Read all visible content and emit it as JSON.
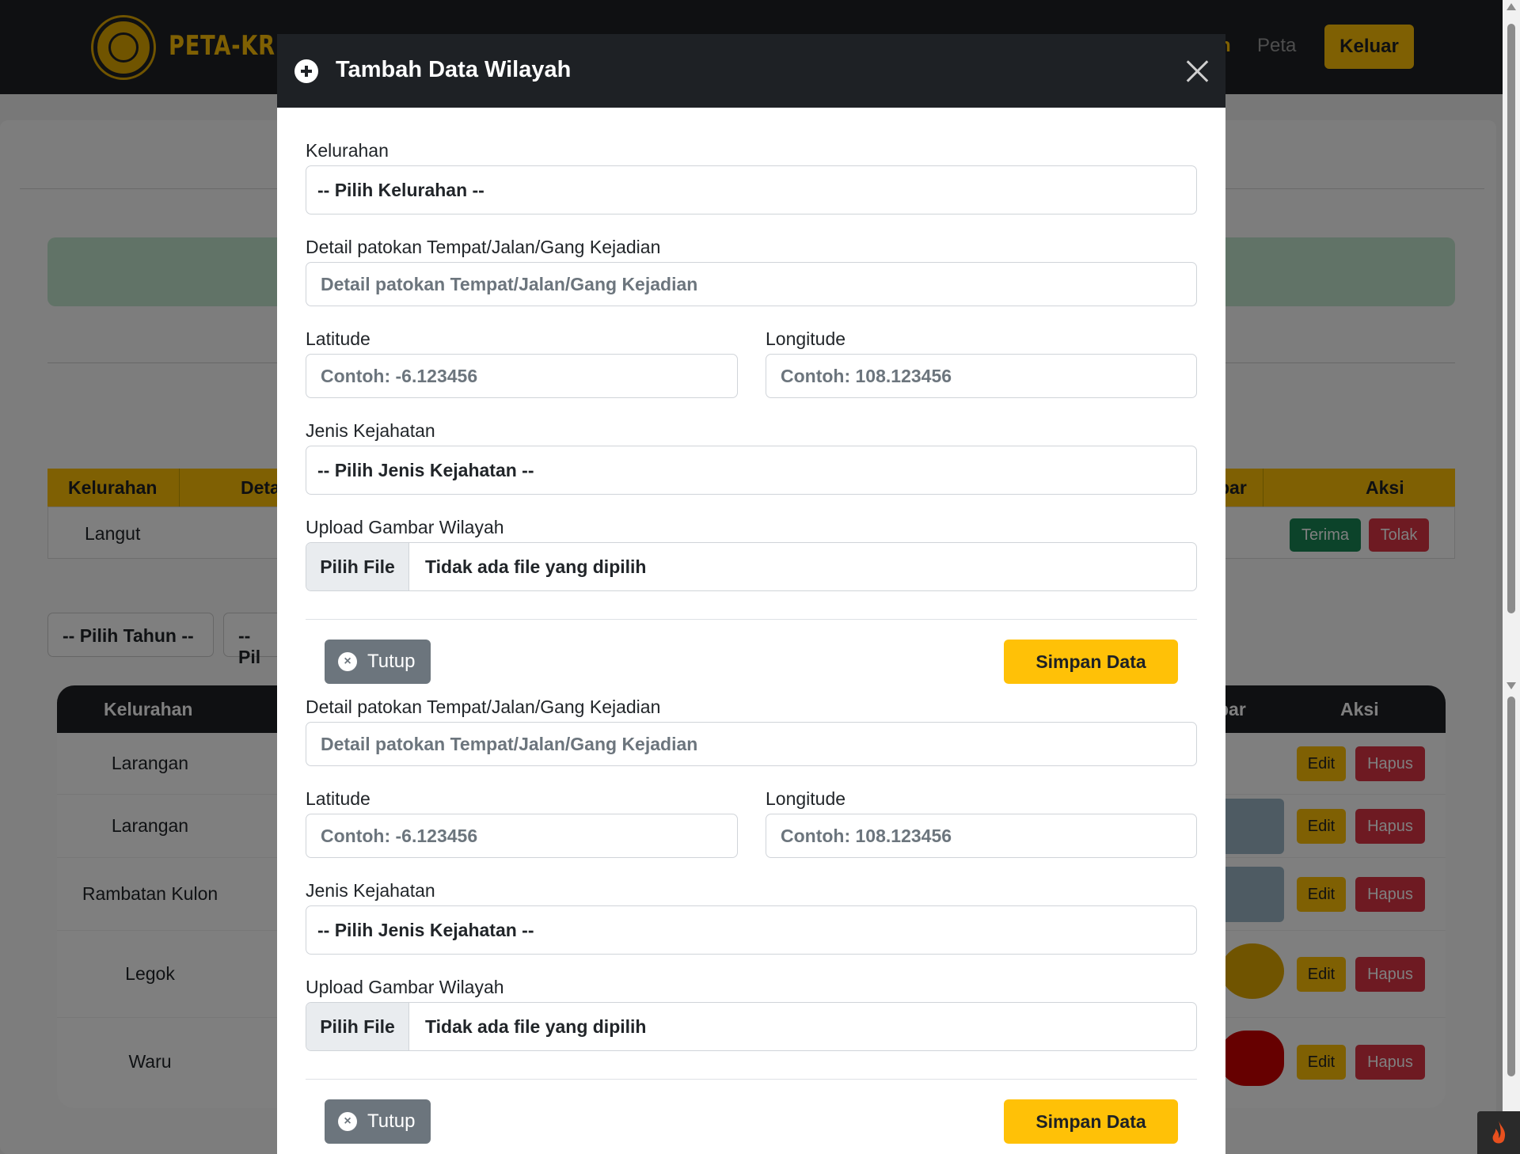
{
  "navbar": {
    "brand": "PETA-KRIM",
    "nav_partial": "h",
    "nav_peta": "Peta",
    "keluar": "Keluar"
  },
  "pending_table": {
    "headers": [
      "Kelurahan",
      "Deta",
      "bar",
      "Aksi"
    ],
    "row": {
      "kelurahan": "Langut",
      "terima": "Terima",
      "tolak": "Tolak"
    }
  },
  "filters": {
    "tahun": "-- Pilih Tahun --",
    "second": "-- Pil"
  },
  "data_table": {
    "headers": [
      "Kelurahan",
      "bar",
      "Aksi"
    ],
    "rows": [
      {
        "kelurahan": "Larangan",
        "edit": "Edit",
        "hapus": "Hapus"
      },
      {
        "kelurahan": "Larangan",
        "edit": "Edit",
        "hapus": "Hapus"
      },
      {
        "kelurahan": "Rambatan Kulon",
        "edit": "Edit",
        "hapus": "Hapus"
      },
      {
        "kelurahan": "Legok",
        "edit": "Edit",
        "hapus": "Hapus"
      },
      {
        "kelurahan": "Waru",
        "edit": "Edit",
        "hapus": "Hapus"
      }
    ]
  },
  "modal": {
    "title": "Tambah Data Wilayah",
    "form1": {
      "kelurahan_label": "Kelurahan",
      "kelurahan_value": "-- Pilih Kelurahan --",
      "detail_label": "Detail patokan Tempat/Jalan/Gang Kejadian",
      "detail_placeholder": "Detail patokan Tempat/Jalan/Gang Kejadian",
      "lat_label": "Latitude",
      "lat_placeholder": "Contoh: -6.123456",
      "lng_label": "Longitude",
      "lng_placeholder": "Contoh: 108.123456",
      "jenis_label": "Jenis Kejahatan",
      "jenis_value": "-- Pilih Jenis Kejahatan --",
      "upload_label": "Upload Gambar Wilayah",
      "file_button": "Pilih File",
      "file_text": "Tidak ada file yang dipilih",
      "tutup": "Tutup",
      "simpan": "Simpan Data"
    },
    "form2": {
      "detail_label": "Detail patokan Tempat/Jalan/Gang Kejadian",
      "detail_placeholder": "Detail patokan Tempat/Jalan/Gang Kejadian",
      "lat_label": "Latitude",
      "lat_placeholder": "Contoh: -6.123456",
      "lng_label": "Longitude",
      "lng_placeholder": "Contoh: 108.123456",
      "jenis_label": "Jenis Kejahatan",
      "jenis_value": "-- Pilih Jenis Kejahatan --",
      "upload_label": "Upload Gambar Wilayah",
      "file_button": "Pilih File",
      "file_text": "Tidak ada file yang dipilih",
      "tutup": "Tutup",
      "simpan": "Simpan Data"
    }
  },
  "colors": {
    "navbar": "#1e2125",
    "accent": "#ffc107",
    "success": "#198754",
    "danger": "#dc3545",
    "secondary": "#6c757d"
  }
}
